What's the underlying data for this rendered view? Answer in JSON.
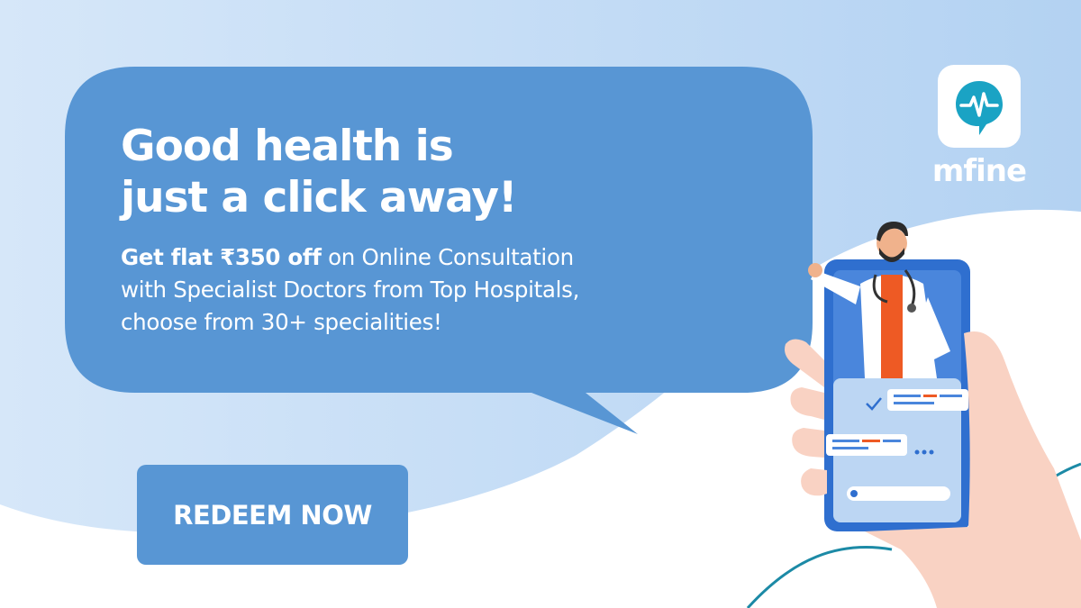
{
  "headline": {
    "line1": "Good health is",
    "line2": "just a click away!"
  },
  "offer": {
    "bold_text": "Get flat ₹350 off",
    "rest_line1": " on Online Consultation",
    "line2": "with Specialist Doctors from Top Hospitals,",
    "line3": "choose from 30+ specialities!"
  },
  "cta": {
    "label": "REDEEM NOW"
  },
  "brand": {
    "name": "mfine",
    "logo_icon": "heartbeat-chat-icon"
  },
  "colors": {
    "background_light": "#c5ddf6",
    "bubble": "#5896d4",
    "logo_accent": "#1aa3c4",
    "teal_curve": "#1c8aa6",
    "doctor_shirt": "#ee5a24"
  }
}
